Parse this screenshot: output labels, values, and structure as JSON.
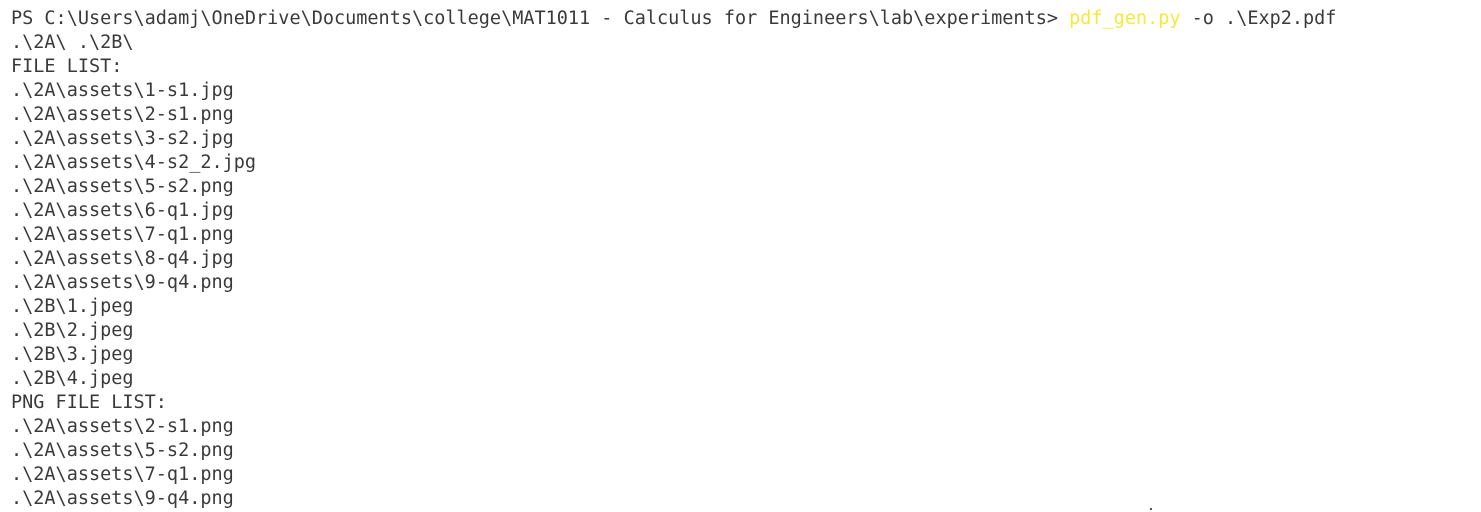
{
  "prompt": {
    "path": "PS C:\\Users\\adamj\\OneDrive\\Documents\\college\\MAT1011 - Calculus for Engineers\\lab\\experiments> ",
    "command": "pdf_gen.py",
    "args": " -o .\\Exp2.pdf"
  },
  "output_lines": [
    ".\\2A\\ .\\2B\\",
    "FILE LIST:",
    ".\\2A\\assets\\1-s1.jpg",
    ".\\2A\\assets\\2-s1.png",
    ".\\2A\\assets\\3-s2.jpg",
    ".\\2A\\assets\\4-s2_2.jpg",
    ".\\2A\\assets\\5-s2.png",
    ".\\2A\\assets\\6-q1.jpg",
    ".\\2A\\assets\\7-q1.png",
    ".\\2A\\assets\\8-q4.jpg",
    ".\\2A\\assets\\9-q4.png",
    ".\\2B\\1.jpeg",
    ".\\2B\\2.jpeg",
    ".\\2B\\3.jpeg",
    ".\\2B\\4.jpeg",
    "PNG FILE LIST:",
    ".\\2A\\assets\\2-s1.png",
    ".\\2A\\assets\\5-s2.png",
    ".\\2A\\assets\\7-q1.png",
    ".\\2A\\assets\\9-q4.png"
  ],
  "colors": {
    "background": "#ffffff",
    "text": "#3a3a3a",
    "command_highlight": "#f6e93c"
  }
}
